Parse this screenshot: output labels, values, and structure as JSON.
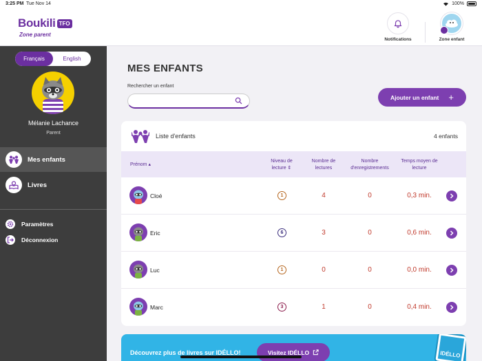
{
  "status_bar": {
    "time": "3:25 PM",
    "date": "Tue Nov 14",
    "battery": "100%"
  },
  "header": {
    "brand": "Boukili",
    "badge": "TFO",
    "subtitle": "Zone parent",
    "notifications_label": "Notifications",
    "zone_enfant_label": "Zone enfant"
  },
  "sidebar": {
    "languages": [
      "Français",
      "English"
    ],
    "active_language": "Français",
    "parent_name": "Mélanie Lachance",
    "parent_role": "Parent",
    "nav": [
      {
        "label": "Mes enfants",
        "icon": "children-icon",
        "active": true
      },
      {
        "label": "Livres",
        "icon": "books-icon",
        "active": false
      }
    ],
    "settings_label": "Paramètres",
    "logout_label": "Déconnexion"
  },
  "main": {
    "title": "MES ENFANTS",
    "search_label": "Rechercher un enfant",
    "search_value": "",
    "search_placeholder": "",
    "add_button": "Ajouter un enfant"
  },
  "children_list": {
    "title": "Liste d'enfants",
    "count": "4 enfants",
    "columns": {
      "name": "Prénom",
      "level": "Niveau de lecture",
      "reads": "Nombre de lectures",
      "recordings": "Nombre d'enregistrements",
      "avg_time": "Temps moyen de lecture"
    },
    "rows": [
      {
        "name": "Cloé",
        "level": "1",
        "level_color": "#b5651d",
        "reads": "4",
        "recordings": "0",
        "avg_time": "0,3 min."
      },
      {
        "name": "Eric",
        "level": "6",
        "level_color": "#3a2d7d",
        "reads": "3",
        "recordings": "0",
        "avg_time": "0,6 min."
      },
      {
        "name": "Luc",
        "level": "1",
        "level_color": "#b5651d",
        "reads": "0",
        "recordings": "0",
        "avg_time": "0,0 min."
      },
      {
        "name": "Marc",
        "level": "3",
        "level_color": "#8b1a4a",
        "reads": "1",
        "recordings": "0",
        "avg_time": "0,4 min."
      }
    ]
  },
  "banner": {
    "text": "Découvrez plus de livres sur IDÉLLO!",
    "button": "Visitez IDÉLLO",
    "phone_label": "IDÉLLO"
  },
  "colors": {
    "purple": "#7d3fb0",
    "sidebar": "#3d3d3d",
    "banner": "#31b4e6",
    "value_red": "#c0392b"
  }
}
